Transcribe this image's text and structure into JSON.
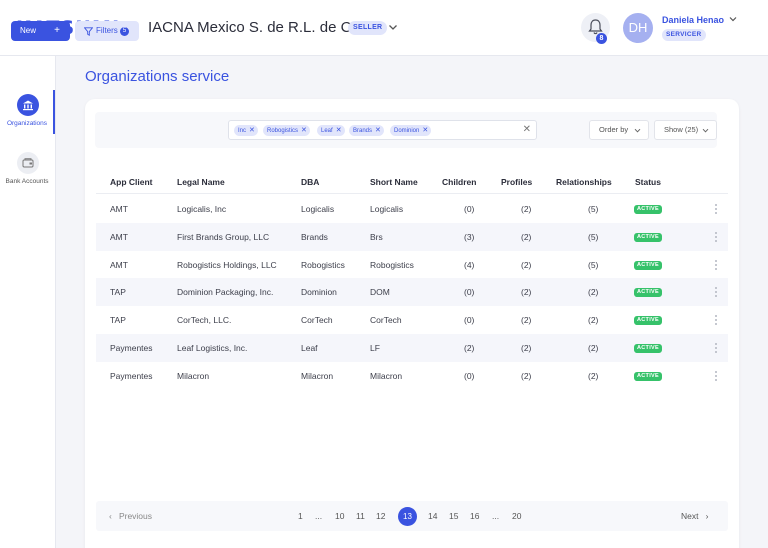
{
  "header": {
    "logo": "KATSUMI",
    "company": "IACNA Mexico S. de R.L. de C.V.",
    "company_badge": "SELLER",
    "notifications": "8",
    "avatar_initials": "DH",
    "user_name": "Daniela Henao",
    "user_role": "SERVICER"
  },
  "sidebar": {
    "items": [
      {
        "label": "Organizations",
        "icon": "bank-icon",
        "active": true
      },
      {
        "label": "Bank Accounts",
        "icon": "wallet-icon",
        "active": false
      }
    ]
  },
  "main": {
    "title": "Organizations service",
    "toolbar": {
      "new_label": "New",
      "filters_label": "Filters",
      "filters_count": "5",
      "chips": [
        "Inc",
        "Robogistics",
        "Leaf",
        "Brands",
        "Dominion"
      ],
      "order_by": "Order by",
      "show": "Show (25)"
    },
    "table": {
      "columns": [
        "App Client",
        "Legal Name",
        "DBA",
        "Short Name",
        "Children",
        "Profiles",
        "Relationships",
        "Status"
      ],
      "rows": [
        [
          "AMT",
          "Logicalis, Inc",
          "Logicalis",
          "Logicalis",
          "(0)",
          "(2)",
          "(5)",
          "ACTIVE"
        ],
        [
          "AMT",
          "First Brands Group, LLC",
          "Brands",
          "Brs",
          "(3)",
          "(2)",
          "(5)",
          "ACTIVE"
        ],
        [
          "AMT",
          "Robogistics Holdings, LLC",
          "Robogistics",
          "Robogistics",
          "(4)",
          "(2)",
          "(5)",
          "ACTIVE"
        ],
        [
          "TAP",
          "Dominion Packaging, Inc.",
          "Dominion",
          "DOM",
          "(0)",
          "(2)",
          "(2)",
          "ACTIVE"
        ],
        [
          "TAP",
          "CorTech, LLC.",
          "CorTech",
          "CorTech",
          "(0)",
          "(2)",
          "(2)",
          "ACTIVE"
        ],
        [
          "Paymentes",
          "Leaf Logistics, Inc.",
          "Leaf",
          "LF",
          "(2)",
          "(2)",
          "(2)",
          "ACTIVE"
        ],
        [
          "Paymentes",
          "Milacron",
          "Milacron",
          "Milacron",
          "(0)",
          "(2)",
          "(2)",
          "ACTIVE"
        ]
      ]
    },
    "pagination": {
      "previous": "Previous",
      "next": "Next",
      "pages": [
        "1",
        "...",
        "10",
        "11",
        "12",
        "13",
        "14",
        "15",
        "16",
        "...",
        "20"
      ],
      "current": "13"
    }
  },
  "colors": {
    "accent": "#3a53e0",
    "active": "#36c26a",
    "background": "#f4f5f9"
  }
}
